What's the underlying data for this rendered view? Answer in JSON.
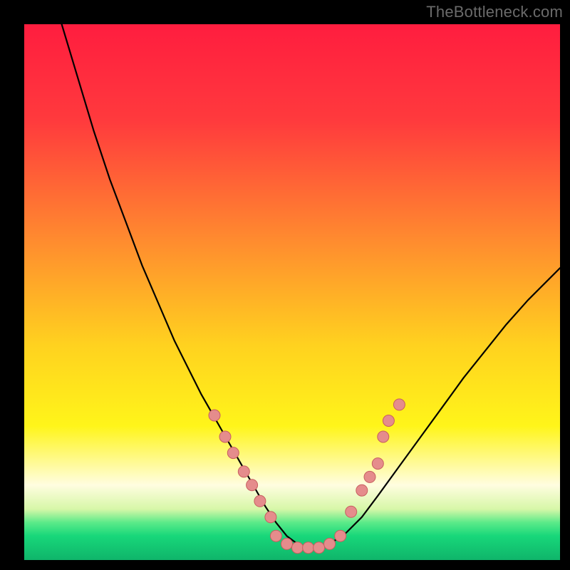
{
  "watermark": "TheBottleneck.com",
  "chart_data": {
    "type": "line",
    "title": "",
    "xlabel": "",
    "ylabel": "",
    "xlim": [
      0,
      100
    ],
    "ylim": [
      0,
      100
    ],
    "grid": false,
    "legend": false,
    "gradient_stops": [
      {
        "offset": 0.0,
        "color": "#ff1d3f"
      },
      {
        "offset": 0.18,
        "color": "#ff3a3d"
      },
      {
        "offset": 0.4,
        "color": "#ff8a2f"
      },
      {
        "offset": 0.6,
        "color": "#ffd21f"
      },
      {
        "offset": 0.75,
        "color": "#fff51a"
      },
      {
        "offset": 0.86,
        "color": "#fffde0"
      },
      {
        "offset": 0.905,
        "color": "#d7f7a8"
      },
      {
        "offset": 0.93,
        "color": "#5bea89"
      },
      {
        "offset": 0.955,
        "color": "#18d77a"
      },
      {
        "offset": 1.0,
        "color": "#0fb56a"
      }
    ],
    "series": [
      {
        "name": "curve",
        "color": "#000000",
        "stroke_width": 2.2,
        "x": [
          7,
          10,
          13,
          16,
          19,
          22,
          25,
          28,
          31,
          33,
          35,
          37,
          39,
          41,
          43,
          45,
          47,
          49,
          51,
          53,
          55,
          57,
          60,
          63,
          66,
          70,
          74,
          78,
          82,
          86,
          90,
          94,
          98,
          100
        ],
        "y": [
          100,
          90,
          80,
          71,
          63,
          55,
          48,
          41,
          35,
          31,
          27.5,
          24,
          20.5,
          17,
          13.5,
          10,
          7,
          4.5,
          3,
          2.3,
          2.3,
          3,
          5,
          8,
          12,
          17.5,
          23,
          28.5,
          34,
          39,
          44,
          48.5,
          52.5,
          54.5
        ]
      }
    ],
    "markers": {
      "color": "#e58c8c",
      "stroke": "#c75f5f",
      "radius": 8,
      "points": [
        {
          "x": 35.5,
          "y": 27
        },
        {
          "x": 37.5,
          "y": 23
        },
        {
          "x": 39,
          "y": 20
        },
        {
          "x": 41,
          "y": 16.5
        },
        {
          "x": 42.5,
          "y": 14
        },
        {
          "x": 44,
          "y": 11
        },
        {
          "x": 46,
          "y": 8
        },
        {
          "x": 47,
          "y": 4.5
        },
        {
          "x": 49,
          "y": 3
        },
        {
          "x": 51,
          "y": 2.3
        },
        {
          "x": 53,
          "y": 2.3
        },
        {
          "x": 55,
          "y": 2.3
        },
        {
          "x": 57,
          "y": 3
        },
        {
          "x": 59,
          "y": 4.5
        },
        {
          "x": 61,
          "y": 9
        },
        {
          "x": 63,
          "y": 13
        },
        {
          "x": 64.5,
          "y": 15.5
        },
        {
          "x": 66,
          "y": 18
        },
        {
          "x": 67,
          "y": 23
        },
        {
          "x": 68,
          "y": 26
        },
        {
          "x": 70,
          "y": 29
        }
      ]
    }
  }
}
